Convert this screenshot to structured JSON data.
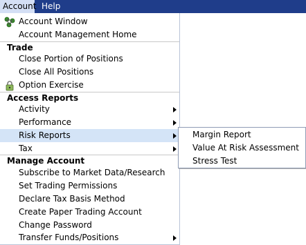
{
  "menubar": {
    "items": [
      {
        "label": "Account",
        "active": true
      },
      {
        "label": "Help",
        "active": false
      }
    ]
  },
  "dropdown": {
    "items": {
      "account_window": "Account Window",
      "account_management_home": "Account Management Home",
      "trade_title": "Trade",
      "close_portion": "Close Portion of Positions",
      "close_all": "Close All Positions",
      "option_exercise": "Option Exercise",
      "access_reports_title": "Access Reports",
      "activity": "Activity",
      "performance": "Performance",
      "risk_reports": "Risk Reports",
      "tax": "Tax",
      "manage_account_title": "Manage Account",
      "subscribe_market_data": "Subscribe to Market Data/Research",
      "set_trading_permissions": "Set Trading Permissions",
      "declare_tax_basis": "Declare Tax Basis Method",
      "create_paper_trading": "Create Paper Trading Account",
      "change_password": "Change Password",
      "transfer_funds": "Transfer Funds/Positions"
    }
  },
  "risk_submenu": {
    "items": {
      "margin_report": "Margin Report",
      "value_at_risk": "Value At Risk Assessment",
      "stress_test": "Stress Test"
    }
  },
  "colors": {
    "menubar_bg": "#1f3d8a",
    "highlight": "#d4e4f7"
  },
  "icons": {
    "account_window": "network-nodes-icon",
    "option_exercise": "padlock-icon"
  }
}
